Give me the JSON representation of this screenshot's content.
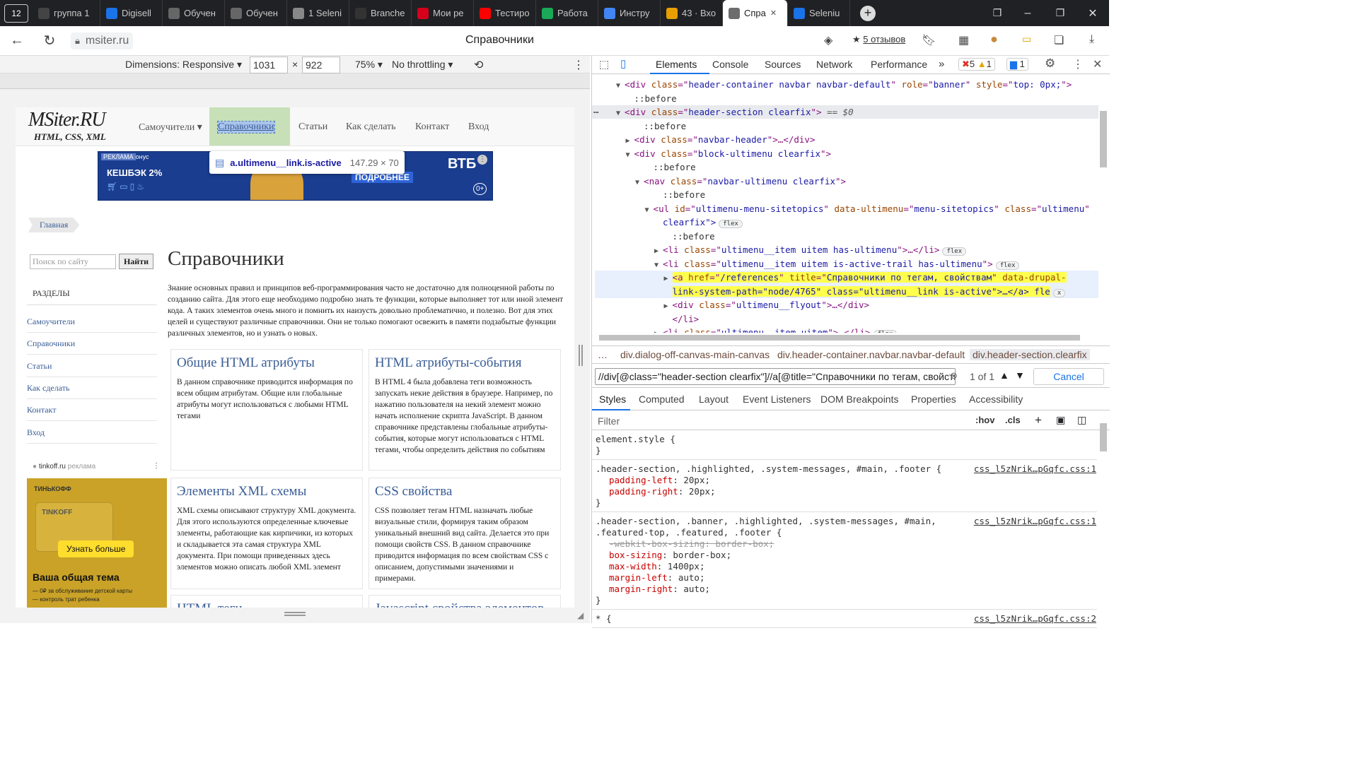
{
  "browser": {
    "tabs": [
      {
        "label": "группа 1",
        "icon": "tab-group-icon"
      },
      {
        "label": "Digisell",
        "icon": "digiseller-icon"
      },
      {
        "label": "Обучен",
        "icon": "openai-icon"
      },
      {
        "label": "Обучен",
        "icon": "openai-icon"
      },
      {
        "label": "1 Seleni",
        "icon": "document-icon"
      },
      {
        "label": "Branche",
        "icon": "github-icon"
      },
      {
        "label": "Мои ре",
        "icon": "hh-icon"
      },
      {
        "label": "Тестиро",
        "icon": "youtube-icon"
      },
      {
        "label": "Работа",
        "icon": "sj-icon"
      },
      {
        "label": "Инстру",
        "icon": "docs-icon"
      },
      {
        "label": "43 · Вхо",
        "icon": "gmail-icon"
      },
      {
        "label": "Спра",
        "icon": "msiter-icon",
        "active": true
      },
      {
        "label": "Seleniu",
        "icon": "selenium-icon"
      }
    ],
    "tab_count": "12",
    "address": "msiter.ru",
    "page_title": "Справочники",
    "reviews": "5 отзывов"
  },
  "device_toolbar": {
    "dimensions": "Dimensions: Responsive",
    "width": "1031",
    "height": "922",
    "times": "×",
    "zoom": "75%",
    "throttling": "No throttling"
  },
  "site": {
    "logo": "MSiter.RU",
    "logo_sub": "HTML, CSS, XML",
    "nav": [
      "Самоучители",
      "Справочники",
      "Статьи",
      "Как сделать",
      "Контакт",
      "Вход"
    ],
    "tooltip_selector": "a.ultimenu__link.is-active",
    "tooltip_size": "147.29 × 70",
    "ad_banner": {
      "tag": "РЕКЛАМА",
      "bonus": "онус",
      "cashback": "КЕШБЭК 2%",
      "cta": "ПОДРОБНЕЕ",
      "brand": "ВТБ",
      "age": "0+"
    },
    "breadcrumb": "Главная",
    "search_placeholder": "Поиск по сайту",
    "search_button": "Найти",
    "sections_title": "РАЗДЕЛЫ",
    "sidebar": [
      "Самоучители",
      "Справочники",
      "Статьи",
      "Как сделать",
      "Контакт",
      "Вход"
    ],
    "side_ad": {
      "domain": "tinkoff.ru",
      "label": "реклама",
      "bank": "ТИНЬКОФФ",
      "card_brand": "TINKOFF",
      "cta": "Узнать больше",
      "headline": "Ваша общая тема",
      "line1": "— 0₽ за обслуживание детской карты",
      "line2": "— контроль трат ребенка"
    },
    "heading": "Справочники",
    "intro": "Знание основных правил и принципов веб-программирования часто не достаточно для полноценной работы по созданию сайта. Для этого еще необходимо подробно знать те функции, которые выполняет тот или иной элемент кода. А таких элементов очень много и помнить их наизусть довольно проблематично, и полезно. Вот для этих целей и существуют различные справочники. Они не только помогают освежить в памяти подзабытые функции различных элементов, но и узнать о новых.",
    "cards": [
      {
        "title": "Общие HTML атрибуты",
        "text": "В данном справочнике приводится информация по всем общим атрибутам. Общие или глобальные атрибуты могут использоваться с любыми HTML тегами"
      },
      {
        "title": "HTML атрибуты-события",
        "text": "В HTML 4 была добавлена теги возможность запускать некие действия в браузере. Например, по нажатию пользователя на некий элемент можно начать исполнение скрипта JavaScript. В данном справочнике представлены глобальные атрибуты-события, которые могут использоваться с HTML тегами, чтобы определить действия по событиям"
      },
      {
        "title": "Элементы XML схемы",
        "text": "XML схемы описывают структуру XML документа. Для этого используются определенные ключевые элементы, работающие как кирпичики, из которых и складывается эта самая структура XML документа. При помощи приведенных здесь элементов можно описать любой XML элемент"
      },
      {
        "title": "CSS свойства",
        "text": "CSS позволяет тегам HTML назначать любые визуальные стили, формируя таким образом уникальный внешний вид сайта. Делается это при помощи свойств CSS. В данном справочнике приводится информация по всем свойствам CSS с описанием, допустимыми значениями и примерами."
      },
      {
        "title": "HTML теги",
        "text": ""
      },
      {
        "title": "Javascript свойства элементов",
        "text": ""
      }
    ]
  },
  "devtools": {
    "tabs": [
      "Elements",
      "Console",
      "Sources",
      "Network",
      "Performance"
    ],
    "more": "»",
    "errors": "5",
    "warnings": "1",
    "messages": "1",
    "dom": [
      {
        "d": 0,
        "arrow": "▼",
        "tag": "div",
        "attrs": [
          [
            "class",
            "header-container navbar navbar-default"
          ],
          [
            "role",
            "banner"
          ],
          [
            "style",
            "top: 0px;"
          ]
        ],
        "close": ">"
      },
      {
        "d": 1,
        "pseudo": "::before"
      },
      {
        "d": 0,
        "arrow": "▼",
        "tag": "div",
        "attrs": [
          [
            "class",
            "header-section clearfix"
          ]
        ],
        "close": ">",
        "suffix": " == $0",
        "selected": true
      },
      {
        "d": 2,
        "pseudo": "::before"
      },
      {
        "d": 1,
        "arrow": "▶",
        "tag": "div",
        "attrs": [
          [
            "class",
            "navbar-header"
          ]
        ],
        "close": ">…</div>"
      },
      {
        "d": 1,
        "arrow": "▼",
        "tag": "div",
        "attrs": [
          [
            "class",
            "block-ultimenu clearfix"
          ]
        ],
        "close": ">"
      },
      {
        "d": 3,
        "pseudo": "::before"
      },
      {
        "d": 2,
        "arrow": "▼",
        "tag": "nav",
        "attrs": [
          [
            "class",
            "navbar-ultimenu clearfix"
          ]
        ],
        "close": ">"
      },
      {
        "d": 4,
        "pseudo": "::before"
      },
      {
        "d": 3,
        "arrow": "▼",
        "tag": "ul",
        "attrs": [
          [
            "id",
            "ultimenu-menu-sitetopics"
          ],
          [
            "data-ultimenu",
            "menu-sitetopics"
          ],
          [
            "class",
            "ultimenu"
          ]
        ],
        "close": ""
      },
      {
        "d": 4,
        "cont": "clearfix\">",
        "badge": "flex"
      },
      {
        "d": 5,
        "pseudo": "::before"
      },
      {
        "d": 4,
        "arrow": "▶",
        "tag": "li",
        "attrs": [
          [
            "class",
            "ultimenu__item uitem has-ultimenu"
          ]
        ],
        "close": ">…</li>",
        "badge": "flex"
      },
      {
        "d": 4,
        "arrow": "▼",
        "tag": "li",
        "attrs": [
          [
            "class",
            "ultimenu__item uitem is-active-trail has-ultimenu"
          ]
        ],
        "close": ">",
        "badge": "flex"
      },
      {
        "d": 5,
        "arrow": "▶",
        "tag": "a",
        "attrs": [
          [
            "href",
            "/references"
          ],
          [
            "title",
            "Справочники по тегам, свойствам"
          ],
          [
            "data-drupal-"
          ]
        ],
        "close": "",
        "highlight": true
      },
      {
        "d": 5,
        "cont": "link-system-path=\"node/4765\" class=\"ultimenu__link is-active\">…</a> fle",
        "highlight": true,
        "badge": "x"
      },
      {
        "d": 5,
        "arrow": "▶",
        "tag": "div",
        "attrs": [
          [
            "class",
            "ultimenu__flyout"
          ]
        ],
        "close": ">…</div>"
      },
      {
        "d": 5,
        "closing": "</li>"
      },
      {
        "d": 4,
        "arrow": "▶",
        "tag": "li",
        "attrs": [
          [
            "class",
            "ultimenu__item uitem"
          ]
        ],
        "close": ">…</li>",
        "badge": "flex"
      }
    ],
    "breadcrumbs": [
      "…",
      "div.dialog-off-canvas-main-canvas",
      "div.header-container.navbar.navbar-default",
      "div.header-section.clearfix"
    ],
    "search_query": "//div[@class=\"header-section clearfix\"]//a[@title=\"Справочники по тегам, свойств",
    "search_count": "1 of 1",
    "cancel": "Cancel",
    "panel_tabs": [
      "Styles",
      "Computed",
      "Layout",
      "Event Listeners",
      "DOM Breakpoints",
      "Properties",
      "Accessibility"
    ],
    "filter_placeholder": "Filter",
    "hov": ":hov",
    "cls": ".cls",
    "rules": [
      {
        "selector": "element.style {",
        "props": [],
        "close": "}"
      },
      {
        "selector": ".header-section, .highlighted, .system-messages, #main, .footer {",
        "source": "css_l5zNrik…pGqfc.css:1",
        "props": [
          [
            "padding-left",
            "20px;"
          ],
          [
            "padding-right",
            "20px;"
          ]
        ],
        "close": "}"
      },
      {
        "selector": ".header-section, .banner, .highlighted, .system-messages, #main,",
        "selector2": ".featured-top, .featured, .footer {",
        "source": "css_l5zNrik…pGqfc.css:1",
        "props": [
          [
            "-webkit-box-sizing",
            "border-box;",
            true
          ],
          [
            "box-sizing",
            "border-box;"
          ],
          [
            "max-width",
            "1400px;"
          ],
          [
            "margin-left",
            "auto;"
          ],
          [
            "margin-right",
            "auto;"
          ]
        ],
        "close": "}"
      },
      {
        "selector": "* {",
        "source": "css_l5zNrik…pGqfc.css:2",
        "props": []
      }
    ]
  },
  "colors": {
    "accent": "#1a73e8",
    "highlight": "#ffff4d",
    "selected_row": "#e8eaed",
    "site_link": "#3a5d96",
    "nav_active": "#c8e0b8"
  }
}
